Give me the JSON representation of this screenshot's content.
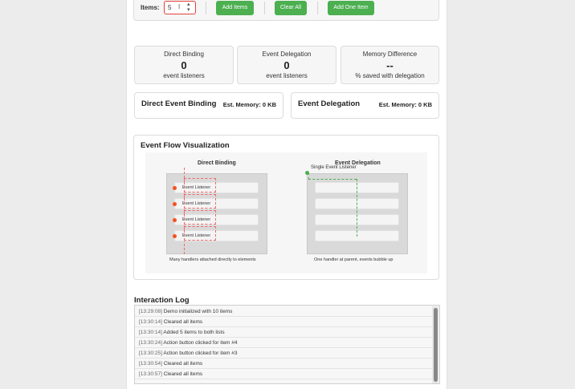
{
  "controls": {
    "items_label": "Items:",
    "items_value": "5",
    "add_items_label": "Add Items",
    "clear_all_label": "Clear All",
    "add_one_label": "Add One Item"
  },
  "stats": [
    {
      "title": "Direct Binding",
      "value": "0",
      "sub": "event listeners"
    },
    {
      "title": "Event Delegation",
      "value": "0",
      "sub": "event listeners"
    },
    {
      "title": "Memory Difference",
      "value": "--",
      "sub": "% saved with delegation"
    }
  ],
  "lists": {
    "direct_title": "Direct Event Binding",
    "direct_memory": "Est. Memory: 0 KB",
    "delegation_title": "Event Delegation",
    "delegation_memory": "Est. Memory: 0 KB"
  },
  "visualization": {
    "title": "Event Flow Visualization",
    "direct_title": "Direct Binding",
    "delegation_title": "Event Delegation",
    "single_listener": "Single Event Listener",
    "row_label": "Event Listener",
    "direct_caption": "Many handlers attached directly to elements",
    "delegation_caption": "One handler at parent, events bubble up",
    "accent_red": "#f4511e",
    "accent_green": "#4caf50"
  },
  "log": {
    "title": "Interaction Log",
    "entries": [
      {
        "time": "[13:29:08]",
        "msg": "Demo initialized with 10 items"
      },
      {
        "time": "[13:30:14]",
        "msg": "Cleared all items"
      },
      {
        "time": "[13:30:14]",
        "msg": "Added 5 items to both lists"
      },
      {
        "time": "[13:30:24]",
        "msg": "Action button clicked for item #4"
      },
      {
        "time": "[13:30:25]",
        "msg": "Action button clicked for item #3"
      },
      {
        "time": "[13:30:54]",
        "msg": "Cleared all items"
      },
      {
        "time": "[13:30:57]",
        "msg": "Cleared all items"
      }
    ]
  }
}
